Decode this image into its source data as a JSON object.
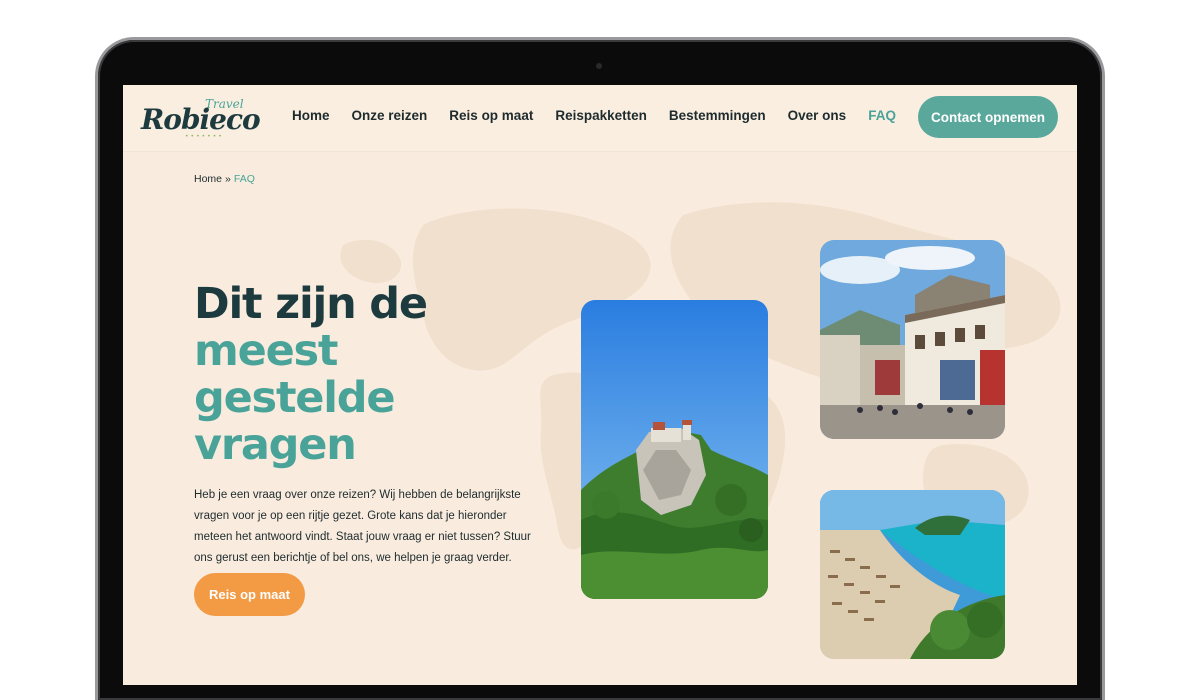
{
  "logo": {
    "main": "Robieco",
    "sub": "Travel",
    "dots": "•••••••"
  },
  "nav": {
    "items": [
      "Home",
      "Onze reizen",
      "Reis op maat",
      "Reispakketten",
      "Bestemmingen",
      "Over ons",
      "FAQ"
    ],
    "active": "FAQ"
  },
  "header": {
    "contact_label": "Contact opnemen"
  },
  "breadcrumb": {
    "home": "Home",
    "separator": "»",
    "current": "FAQ"
  },
  "hero": {
    "title_line1": "Dit zijn de",
    "title_line2": "meest gestelde vragen",
    "text": "Heb je een vraag over onze reizen? Wij hebben de belangrijkste vragen voor je op een rijtje gezet. Grote kans dat je hieronder meteen het antwoord vindt. Staat jouw vraag er niet tussen? Stuur ons gerust een berichtje of bel ons, we helpen je graag verder.",
    "cta_label": "Reis op maat"
  },
  "colors": {
    "background": "#f9ecdf",
    "dark": "#1d3b3f",
    "teal": "#4aa398",
    "button_teal": "#5aa89c",
    "orange": "#f39a45"
  }
}
